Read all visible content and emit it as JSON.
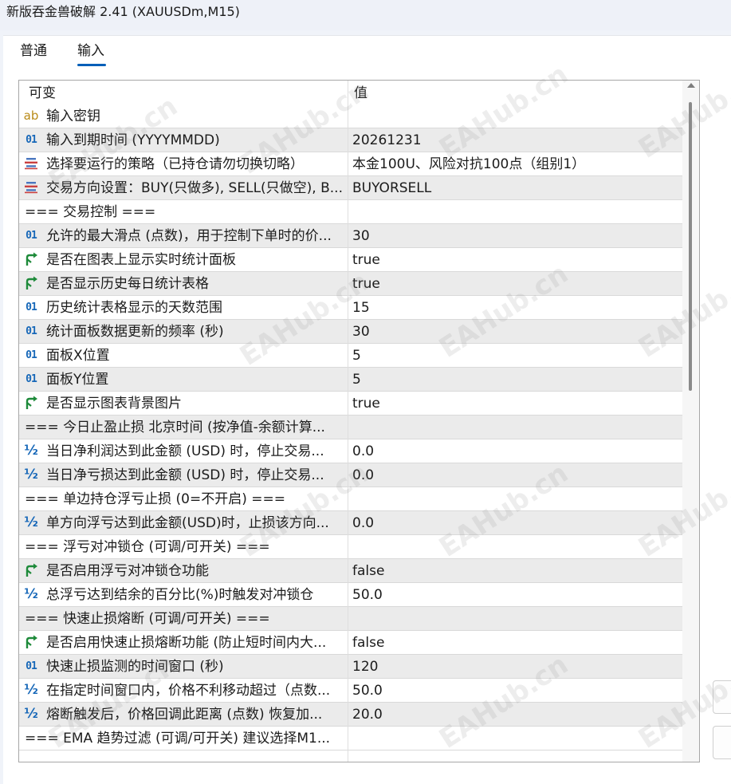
{
  "window": {
    "title": "新版吞金兽破解 2.41 (XAUUSDm,M15)"
  },
  "tabs": [
    {
      "label": "普通"
    },
    {
      "label": "输入"
    }
  ],
  "grid": {
    "columns": [
      "可变",
      "值"
    ],
    "rows": [
      {
        "icon": "ab",
        "name": "输入密钥",
        "value": ""
      },
      {
        "icon": "int",
        "name": "输入到期时间 (YYYYMMDD)",
        "value": "20261231"
      },
      {
        "icon": "enum",
        "name": "选择要运行的策略（已持仓请勿切换切略）",
        "value": "本金100U、风险对抗100点（组别1）"
      },
      {
        "icon": "enum",
        "name": "交易方向设置：BUY(只做多), SELL(只做空), B...",
        "value": "BUYORSELL"
      },
      {
        "icon": "",
        "name": "=== 交易控制 ===",
        "value": ""
      },
      {
        "icon": "int",
        "name": "允许的最大滑点 (点数)，用于控制下单时的价...",
        "value": "30"
      },
      {
        "icon": "bool",
        "name": "是否在图表上显示实时统计面板",
        "value": "true"
      },
      {
        "icon": "bool",
        "name": "是否显示历史每日统计表格",
        "value": "true"
      },
      {
        "icon": "int",
        "name": "历史统计表格显示的天数范围",
        "value": "15"
      },
      {
        "icon": "int",
        "name": "统计面板数据更新的频率 (秒)",
        "value": "30"
      },
      {
        "icon": "int",
        "name": "面板X位置",
        "value": "5"
      },
      {
        "icon": "int",
        "name": "面板Y位置",
        "value": "5"
      },
      {
        "icon": "bool",
        "name": "是否显示图表背景图片",
        "value": "true"
      },
      {
        "icon": "",
        "name": "=== 今日止盈止损 北京时间 (按净值-余额计算...",
        "value": ""
      },
      {
        "icon": "double",
        "name": "当日净利润达到此金额 (USD) 时，停止交易...",
        "value": "0.0"
      },
      {
        "icon": "double",
        "name": "当日净亏损达到此金额 (USD) 时，停止交易...",
        "value": "0.0"
      },
      {
        "icon": "",
        "name": "=== 单边持仓浮亏止损 (0=不开启) ===",
        "value": ""
      },
      {
        "icon": "double",
        "name": "单方向浮亏达到此金额(USD)时，止损该方向...",
        "value": "0.0"
      },
      {
        "icon": "",
        "name": "=== 浮亏对冲锁仓 (可调/可开关)  ===",
        "value": ""
      },
      {
        "icon": "bool",
        "name": "是否启用浮亏对冲锁仓功能",
        "value": "false"
      },
      {
        "icon": "double",
        "name": "总浮亏达到结余的百分比(%)时触发对冲锁仓",
        "value": "50.0"
      },
      {
        "icon": "",
        "name": "=== 快速止损熔断 (可调/可开关)  ===",
        "value": ""
      },
      {
        "icon": "bool",
        "name": "是否启用快速止损熔断功能 (防止短时间内大...",
        "value": "false"
      },
      {
        "icon": "int",
        "name": "快速止损监测的时间窗口 (秒)",
        "value": "120"
      },
      {
        "icon": "double",
        "name": "在指定时间窗口内，价格不利移动超过（点数...",
        "value": "50.0"
      },
      {
        "icon": "double",
        "name": "熔断触发后，价格回调此距离 (点数) 恢复加...",
        "value": "20.0"
      },
      {
        "icon": "",
        "name": "=== EMA 趋势过滤 (可调/可开关) 建议选择M1...",
        "value": ""
      }
    ]
  },
  "watermark": "EAHub.cn",
  "colors": {
    "accent": "#005fb8",
    "row_alt": "#ebebeb",
    "icon_int": "#1667b8",
    "icon_bool": "#1e8a3a",
    "icon_ab": "#b98a17",
    "icon_enum": "#c94040"
  }
}
